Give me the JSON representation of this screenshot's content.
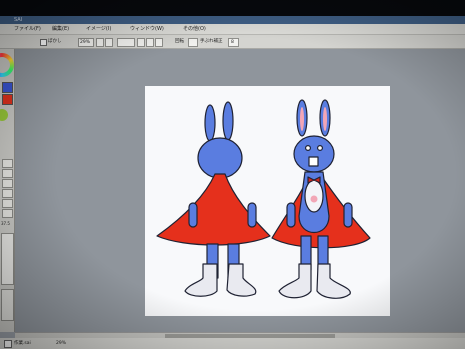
{
  "window": {
    "title": "SAI",
    "menus": [
      "ファイル(F)",
      "編集(E)",
      "イメージ(I)",
      "ウィンドウ(W)",
      "その他(O)"
    ]
  },
  "toolbar": {
    "option_label": "ぼかし",
    "zoom_value": "29%",
    "rotate_label": "回転",
    "flip_label": "手ぶれ補正",
    "stabilizer_value": "8"
  },
  "left_panel": {
    "primary_color": "#3a56d6",
    "secondary_color": "#e2321d",
    "size_value": "37.5"
  },
  "status": {
    "file_name": "作業.sai",
    "zoom": "29%"
  },
  "artwork": {
    "description_icons": [
      "bunny-back-view",
      "bunny-front-view"
    ],
    "colors": {
      "body": "#5a7de0",
      "cape": "#e5301c",
      "boots": "#e9eaf0",
      "outline": "#1f2233"
    }
  }
}
